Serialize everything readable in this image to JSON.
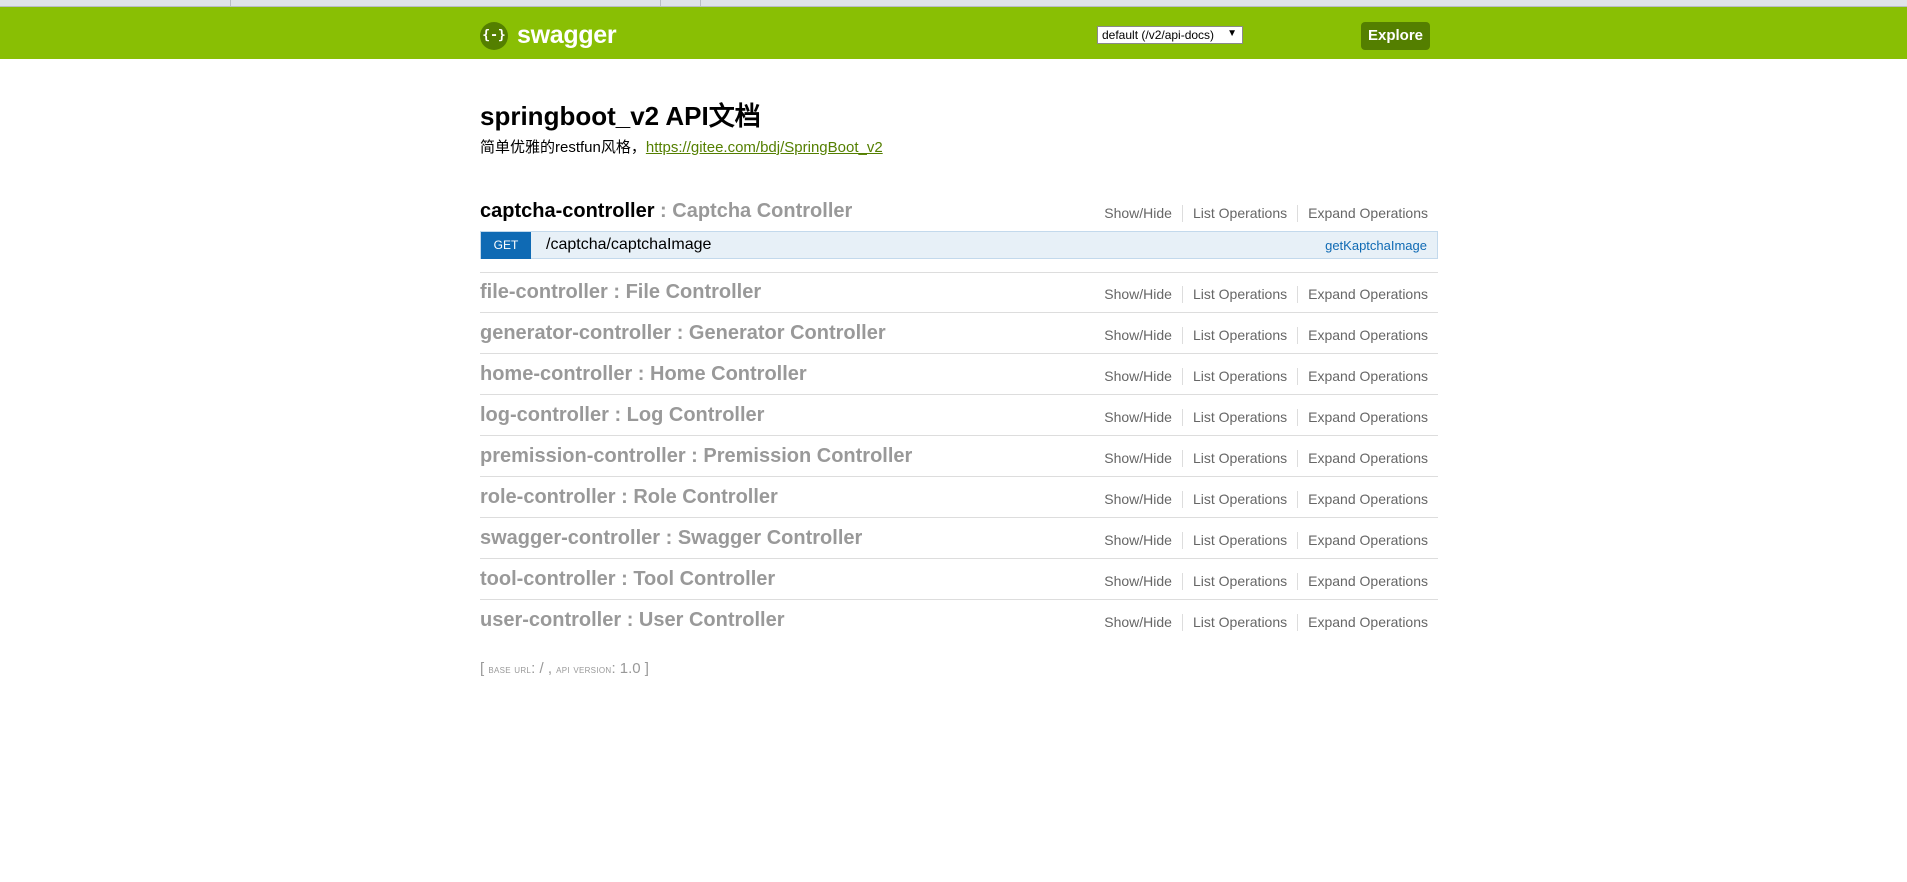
{
  "header": {
    "logo_icon": "{-}",
    "logo_text": "swagger",
    "spec_select": "default (/v2/api-docs)",
    "spec_arrow": "▼",
    "explore_label": "Explore"
  },
  "info": {
    "title": "springboot_v2 API文档",
    "description": "简单优雅的restfun风格，",
    "link": "https://gitee.com/bdj/SpringBoot_v2"
  },
  "link_labels": {
    "show_hide": "Show/Hide",
    "list_ops": "List Operations",
    "expand_ops": "Expand Operations"
  },
  "resources": [
    {
      "path": "captcha-controller",
      "desc": " : Captcha Controller"
    },
    {
      "path": "file-controller",
      "desc": " : File Controller"
    },
    {
      "path": "generator-controller",
      "desc": " : Generator Controller"
    },
    {
      "path": "home-controller",
      "desc": " : Home Controller"
    },
    {
      "path": "log-controller",
      "desc": " : Log Controller"
    },
    {
      "path": "premission-controller",
      "desc": " : Premission Controller"
    },
    {
      "path": "role-controller",
      "desc": " : Role Controller"
    },
    {
      "path": "swagger-controller",
      "desc": " : Swagger Controller"
    },
    {
      "path": "tool-controller",
      "desc": " : Tool Controller"
    },
    {
      "path": "user-controller",
      "desc": " : User Controller"
    }
  ],
  "operation": {
    "method": "GET",
    "path": "/captcha/captchaImage",
    "summary": "getKaptchaImage"
  },
  "footer": {
    "open": "[ ",
    "base_url_label": "base url",
    "base_url": ": / , ",
    "api_version_label": "api version",
    "api_version": ": 1.0",
    "close": " ]"
  },
  "colors": {
    "header_bg": "#89bf04",
    "accent": "#547f00",
    "get_method": "#0f6ab4"
  }
}
